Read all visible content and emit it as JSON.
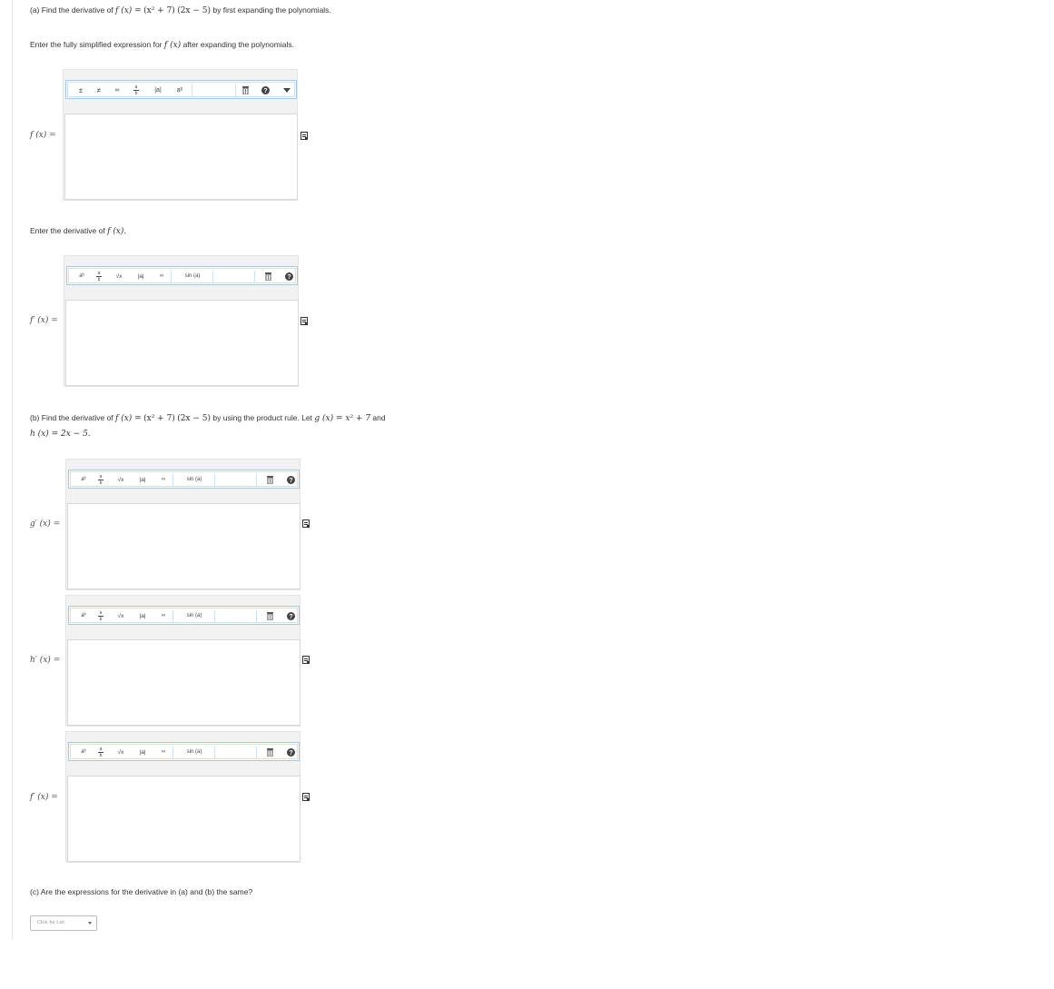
{
  "part_a": {
    "prompt_prefix": "(a) Find the derivative of",
    "prompt_func": "f (x) =",
    "prompt_expr_1": "(x² + 7)",
    "prompt_expr_2": "(2x − 5)",
    "prompt_suffix": "by first expanding the polynomials.",
    "instruction_1": "Enter the fully simplified expression for",
    "instruction_1_func": "f (x)",
    "instruction_1_suffix": "after expanding the polynomials.",
    "label_1": "f (x)",
    "instruction_2": "Enter the derivative of",
    "instruction_2_func": "f (x).",
    "label_2": "f′ (x)"
  },
  "part_b": {
    "prompt_prefix": "(b) Find the derivative of",
    "prompt_func": "f (x) =",
    "prompt_expr_1": "(x² + 7)",
    "prompt_expr_2": "(2x − 5)",
    "prompt_mid": "by using the product rule. Let",
    "prompt_g": "g (x) = x² + 7",
    "prompt_and": "and",
    "line2_h": "h (x) = 2x − 5.",
    "label_g": "g′ (x)",
    "label_h": "h′ (x)",
    "label_f": "f′ (x)"
  },
  "part_c": {
    "prompt": "(c) Are the expressions for the derivative in (a) and (b) the same?",
    "select_placeholder": "Click for List"
  },
  "equals": "=",
  "toolbar_full": {
    "plus_minus": "±",
    "not_equal": "≠",
    "infinity": "∞",
    "fraction_num": "a",
    "fraction_den": "b",
    "abs": "|a|",
    "power": "aᵇ"
  },
  "toolbar_std": {
    "power": "aᵇ",
    "fraction_num": "a",
    "fraction_den": "b",
    "sqrt": "√x",
    "abs": "|a|",
    "infinity": "∞",
    "sin": "sin (a)"
  },
  "icons": {
    "trash": "trash-icon",
    "help": "help-icon",
    "more": "chevron-down-icon",
    "doc": "document-icon"
  },
  "colors": {
    "toolbar_border": "#a9c7e3",
    "editor_bg": "#f2f2f2",
    "icon_dark": "#333333"
  }
}
